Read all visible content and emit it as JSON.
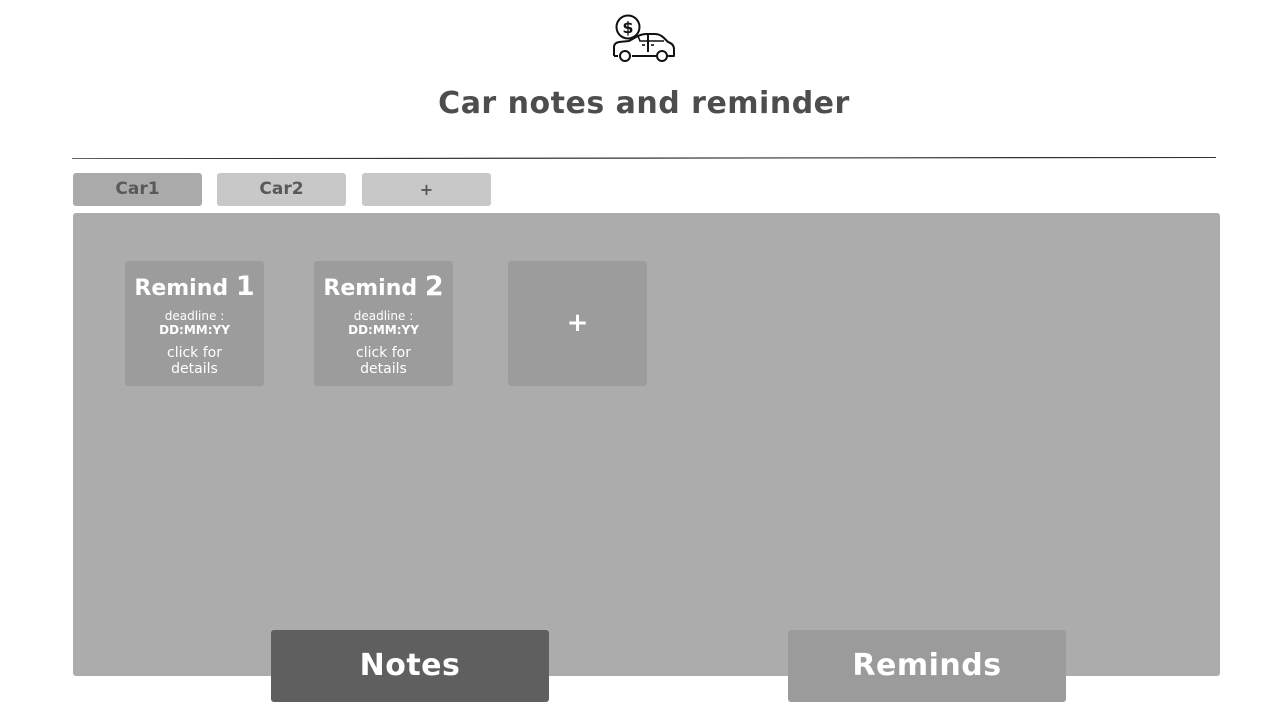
{
  "header": {
    "logo_icon": "car-dollar-icon",
    "title": "Car notes and reminder"
  },
  "tabs": [
    {
      "label": "Car1",
      "active": true
    },
    {
      "label": "Car2",
      "active": false
    },
    {
      "label": "+",
      "active": false
    }
  ],
  "reminders": [
    {
      "title_word": "Remind",
      "title_number": "1",
      "deadline_label": "deadline :",
      "deadline_value": "DD:MM:YY",
      "details": "click for\n details"
    },
    {
      "title_word": "Remind",
      "title_number": "2",
      "deadline_label": "deadline :",
      "deadline_value": "DD:MM:YY",
      "details": "click for\n details"
    }
  ],
  "add_reminder": {
    "symbol": "+"
  },
  "bottom_nav": {
    "notes_label": "Notes",
    "reminds_label": "Reminds"
  },
  "colors": {
    "title_text": "#4d4d4d",
    "panel_bg": "#acacac",
    "card_bg": "#9c9c9c",
    "tab_active_bg": "#aaaaaa",
    "tab_inactive_bg": "#c8c8c8",
    "notes_button_bg": "#5f5f5f",
    "reminds_button_bg": "#9b9b9b"
  }
}
